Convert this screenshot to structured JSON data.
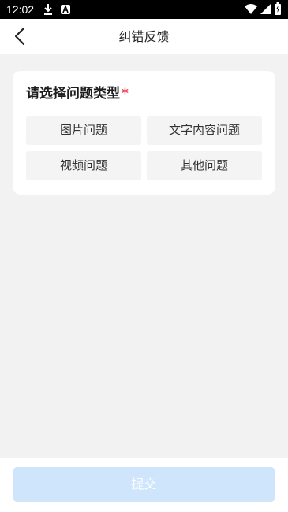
{
  "status_bar": {
    "time": "12:02",
    "left_icons": [
      "download-icon",
      "app-notification-icon"
    ],
    "right_icons": [
      "wifi-icon",
      "signal-icon",
      "battery-icon"
    ]
  },
  "header": {
    "title": "纠错反馈",
    "back_icon": "chevron-left-icon"
  },
  "form": {
    "question_label": "请选择问题类型",
    "required_mark": "*",
    "options": [
      "图片问题",
      "文字内容问题",
      "视频问题",
      "其他问题"
    ]
  },
  "footer": {
    "submit_label": "提交"
  },
  "colors": {
    "background": "#f2f2f2",
    "required": "#f0415a",
    "submit_disabled": "#cfe5fb"
  }
}
